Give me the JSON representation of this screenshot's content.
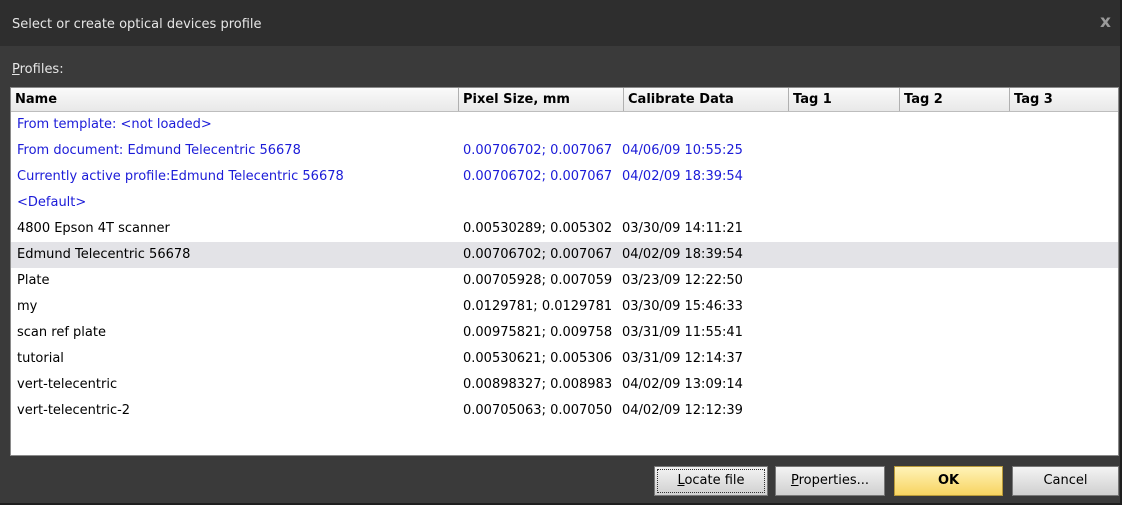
{
  "window": {
    "title": "Select or create optical devices profile",
    "close_glyph": "x"
  },
  "profiles_label": {
    "accel": "P",
    "rest": "rofiles:"
  },
  "columns": [
    "Name",
    "Pixel Size, mm",
    "Calibrate Data",
    "Tag 1",
    "Tag 2",
    "Tag 3"
  ],
  "rows": [
    {
      "name": "From template: <not loaded>",
      "pixel": "",
      "date": "",
      "style": "blue"
    },
    {
      "name": "From document: Edmund Telecentric 56678",
      "pixel": "0.00706702; 0.007067",
      "date": "04/06/09 10:55:25",
      "style": "blue"
    },
    {
      "name": "Currently active profile:Edmund Telecentric 56678",
      "pixel": "0.00706702; 0.007067",
      "date": "04/02/09 18:39:54",
      "style": "blue"
    },
    {
      "name": "<Default>",
      "pixel": "",
      "date": "",
      "style": "blue"
    },
    {
      "name": "4800 Epson 4T scanner",
      "pixel": "0.00530289; 0.005302",
      "date": "03/30/09 14:11:21",
      "style": "normal"
    },
    {
      "name": "Edmund Telecentric 56678",
      "pixel": "0.00706702; 0.007067",
      "date": "04/02/09 18:39:54",
      "style": "selected"
    },
    {
      "name": "Plate",
      "pixel": "0.00705928; 0.007059",
      "date": "03/23/09 12:22:50",
      "style": "normal"
    },
    {
      "name": "my",
      "pixel": "0.0129781; 0.0129781",
      "date": "03/30/09 15:46:33",
      "style": "normal"
    },
    {
      "name": "scan ref plate",
      "pixel": "0.00975821; 0.009758",
      "date": "03/31/09 11:55:41",
      "style": "normal"
    },
    {
      "name": "tutorial",
      "pixel": "0.00530621; 0.005306",
      "date": "03/31/09 12:14:37",
      "style": "normal"
    },
    {
      "name": "vert-telecentric",
      "pixel": "0.00898327; 0.008983",
      "date": "04/02/09 13:09:14",
      "style": "normal"
    },
    {
      "name": "vert-telecentric-2",
      "pixel": "0.00705063; 0.007050",
      "date": "04/02/09 12:12:39",
      "style": "normal"
    }
  ],
  "buttons": {
    "locate": {
      "accel": "L",
      "rest": "ocate file"
    },
    "properties": {
      "accel": "P",
      "rest": "roperties..."
    },
    "ok": "OK",
    "cancel": "Cancel"
  },
  "colors": {
    "link_blue": "#1b1bd8",
    "ok_yellow": "#f7d461",
    "title_bg": "#2e2e2e",
    "body_bg": "#3a3a3a"
  }
}
